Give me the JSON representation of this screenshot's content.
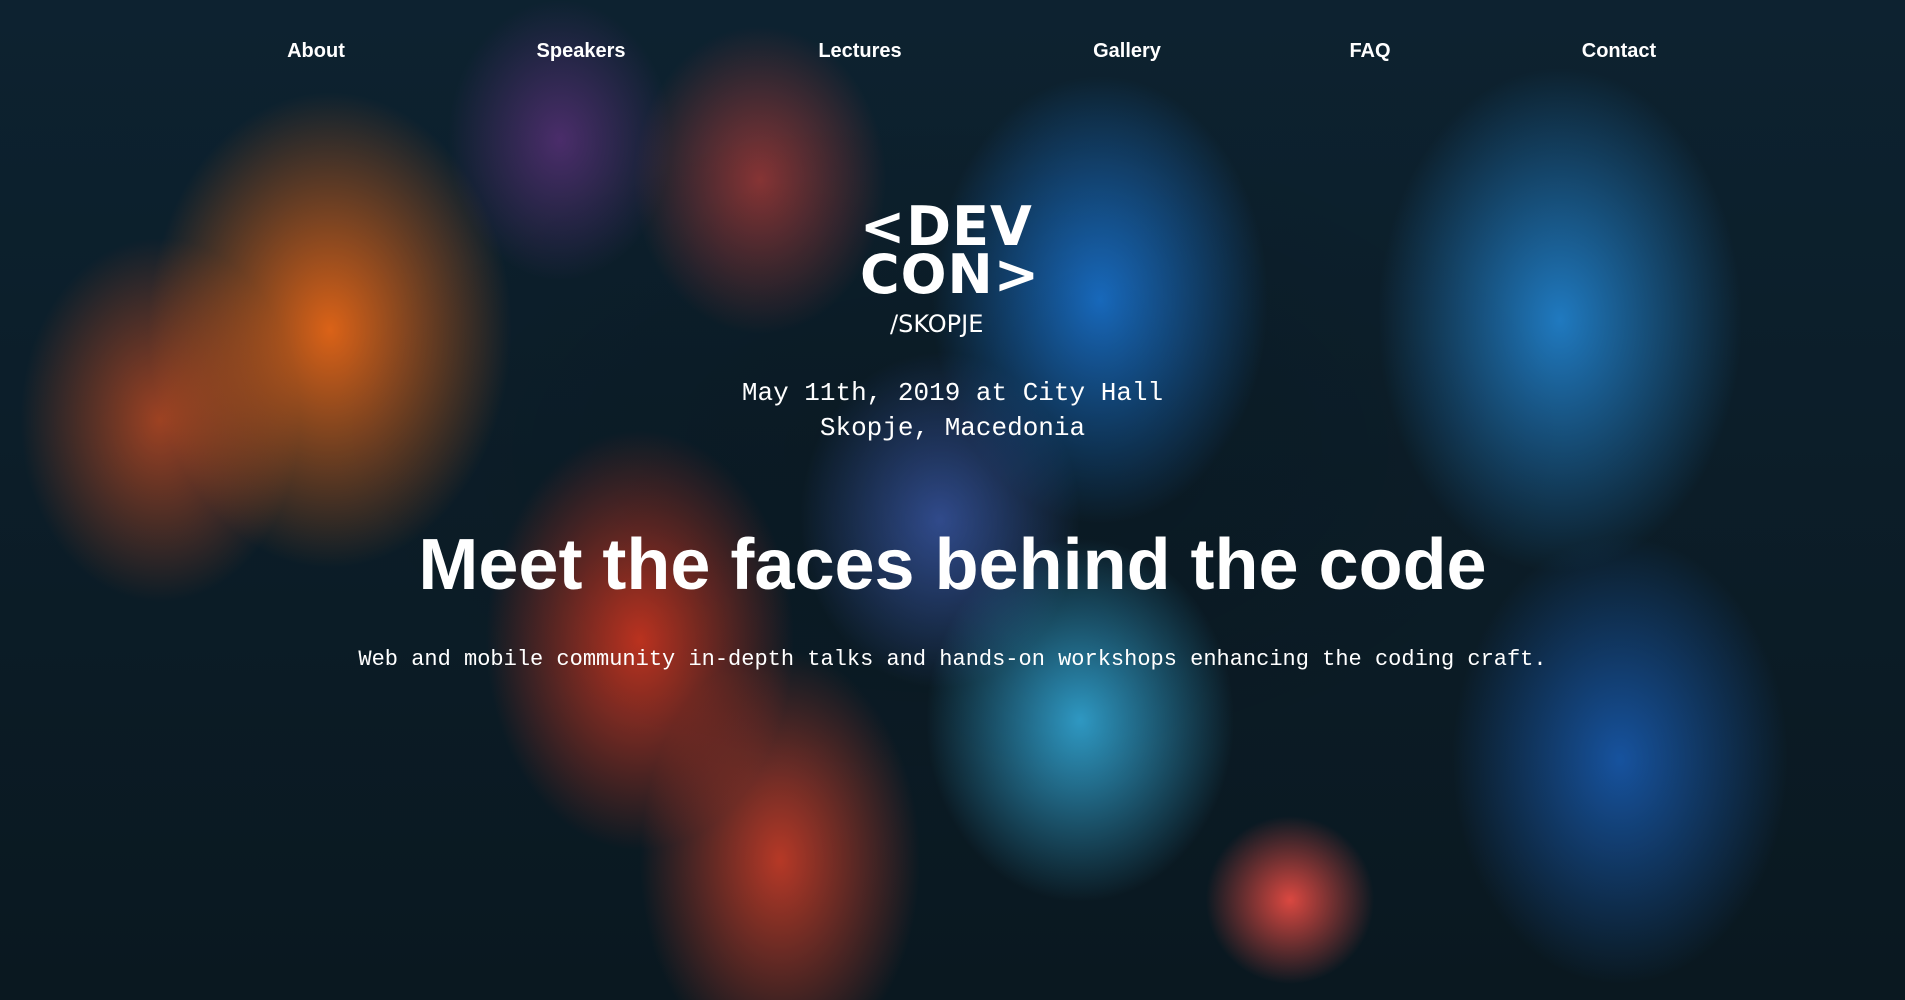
{
  "nav": {
    "items": [
      {
        "label": "About"
      },
      {
        "label": "Speakers"
      },
      {
        "label": "Lectures"
      },
      {
        "label": "Gallery"
      },
      {
        "label": "FAQ"
      },
      {
        "label": "Contact"
      }
    ]
  },
  "logo": {
    "line1": "<DEV",
    "line2": "CON>",
    "line3": "/SKOPJE"
  },
  "event": {
    "date_venue": "May 11th, 2019 at City Hall",
    "location": "Skopje, Macedonia"
  },
  "hero": {
    "headline": "Meet the faces behind the code",
    "tagline": "Web and mobile community in-depth talks and hands-on workshops enhancing the coding craft."
  },
  "colors": {
    "text": "#ffffff",
    "background_dark": "#0b1a24",
    "accent_orange": "#ff6e14",
    "accent_blue": "#1e8cff"
  }
}
